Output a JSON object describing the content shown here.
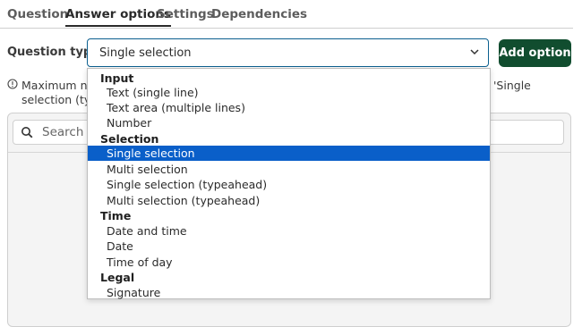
{
  "tabs": [
    {
      "label": "Question",
      "active": false
    },
    {
      "label": "Answer options",
      "active": true
    },
    {
      "label": "Settings",
      "active": false
    },
    {
      "label": "Dependencies",
      "active": false
    }
  ],
  "question_type": {
    "label": "Question type",
    "selected_value": "Single selection"
  },
  "add_option_button": "Add option",
  "info": {
    "line1_left": "Maximum nu",
    "line1_right": "'Single",
    "line2_left": "selection (typ"
  },
  "search": {
    "placeholder": "Search"
  },
  "dropdown": {
    "groups": [
      {
        "label": "Input",
        "items": [
          "Text (single line)",
          "Text area (multiple lines)",
          "Number"
        ]
      },
      {
        "label": "Selection",
        "items": [
          "Single selection",
          "Multi selection",
          "Single selection (typeahead)",
          "Multi selection (typeahead)"
        ]
      },
      {
        "label": "Time",
        "items": [
          "Date and time",
          "Date",
          "Time of day"
        ]
      },
      {
        "label": "Legal",
        "items": [
          "Signature"
        ]
      }
    ],
    "highlighted_item": "Single selection"
  },
  "colors": {
    "accent_border": "#0b5f8f",
    "primary_button": "#114d2f",
    "selection_highlight": "#0a5fc9"
  }
}
